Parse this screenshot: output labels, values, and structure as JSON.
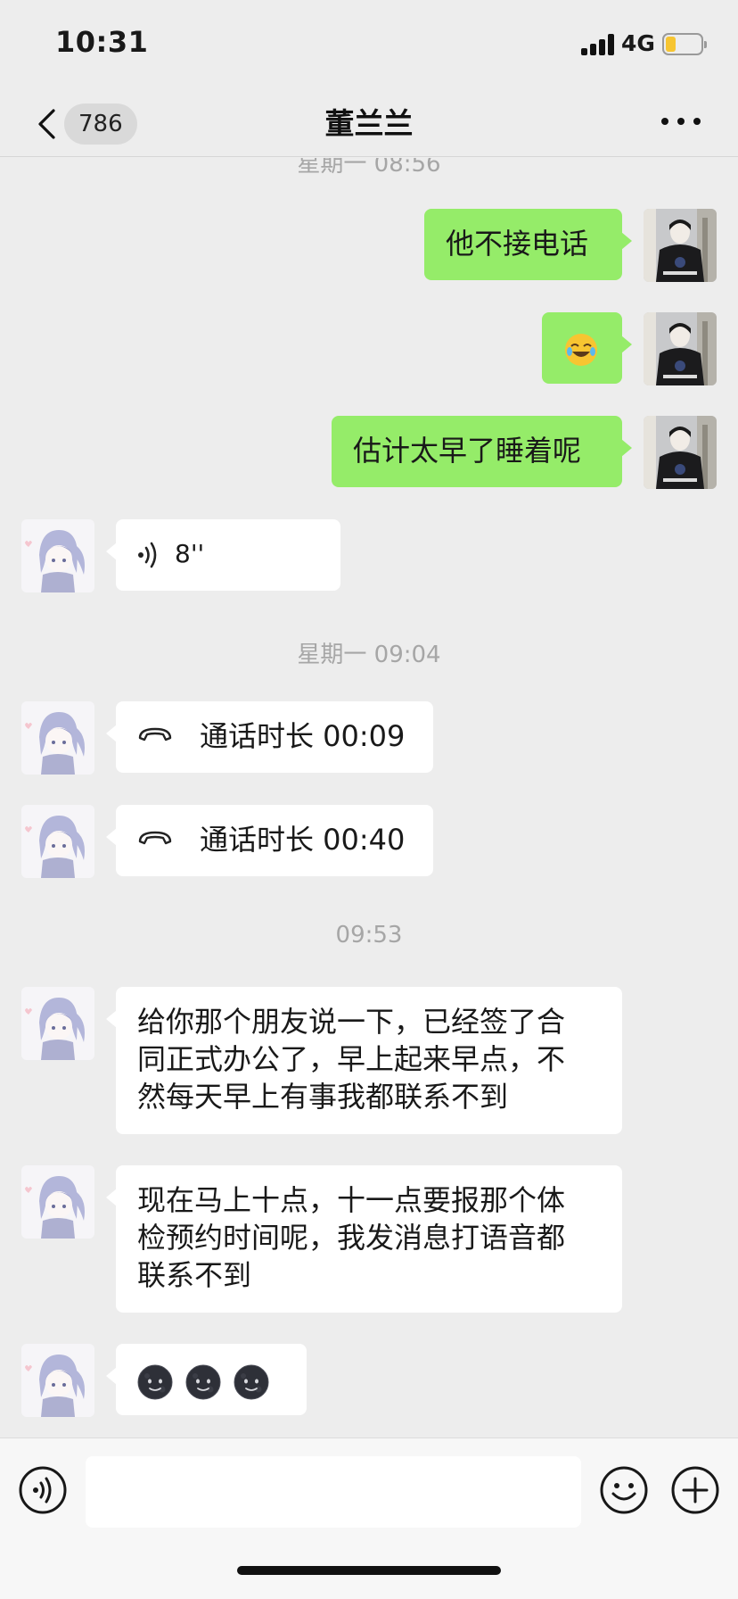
{
  "status_bar": {
    "time": "10:31",
    "network": "4G",
    "battery_fill": 0.3
  },
  "nav": {
    "unread_count": "786",
    "title": "董兰兰"
  },
  "messages": {
    "ts_top": "星期一 08:56",
    "m1_text": "他不接电话",
    "m2_emoji": "rolling-on-floor-laughing",
    "m3_text": "估计太早了睡着呢",
    "m4_voice_duration": "8''",
    "ts_2": "星期一 09:04",
    "m5_call": "通话时长 00:09",
    "m6_call": "通话时长 00:40",
    "ts_3": "09:53",
    "m7_lines": [
      "给你那个朋友说一下，已经签了合",
      "同正式办公了，早上起来早点，不",
      "然每天早上有事我都联系不到"
    ],
    "m8_lines": [
      "现在马上十点，十一点要报那个体",
      "检预约时间呢，我发消息打语音都",
      "联系不到"
    ],
    "m9_emojis": [
      "new-moon-face",
      "new-moon-face",
      "new-moon-face"
    ]
  },
  "colors": {
    "my_bubble": "#95ec69",
    "their_bubble": "#ffffff",
    "background": "#ededed"
  },
  "input": {
    "placeholder": ""
  }
}
